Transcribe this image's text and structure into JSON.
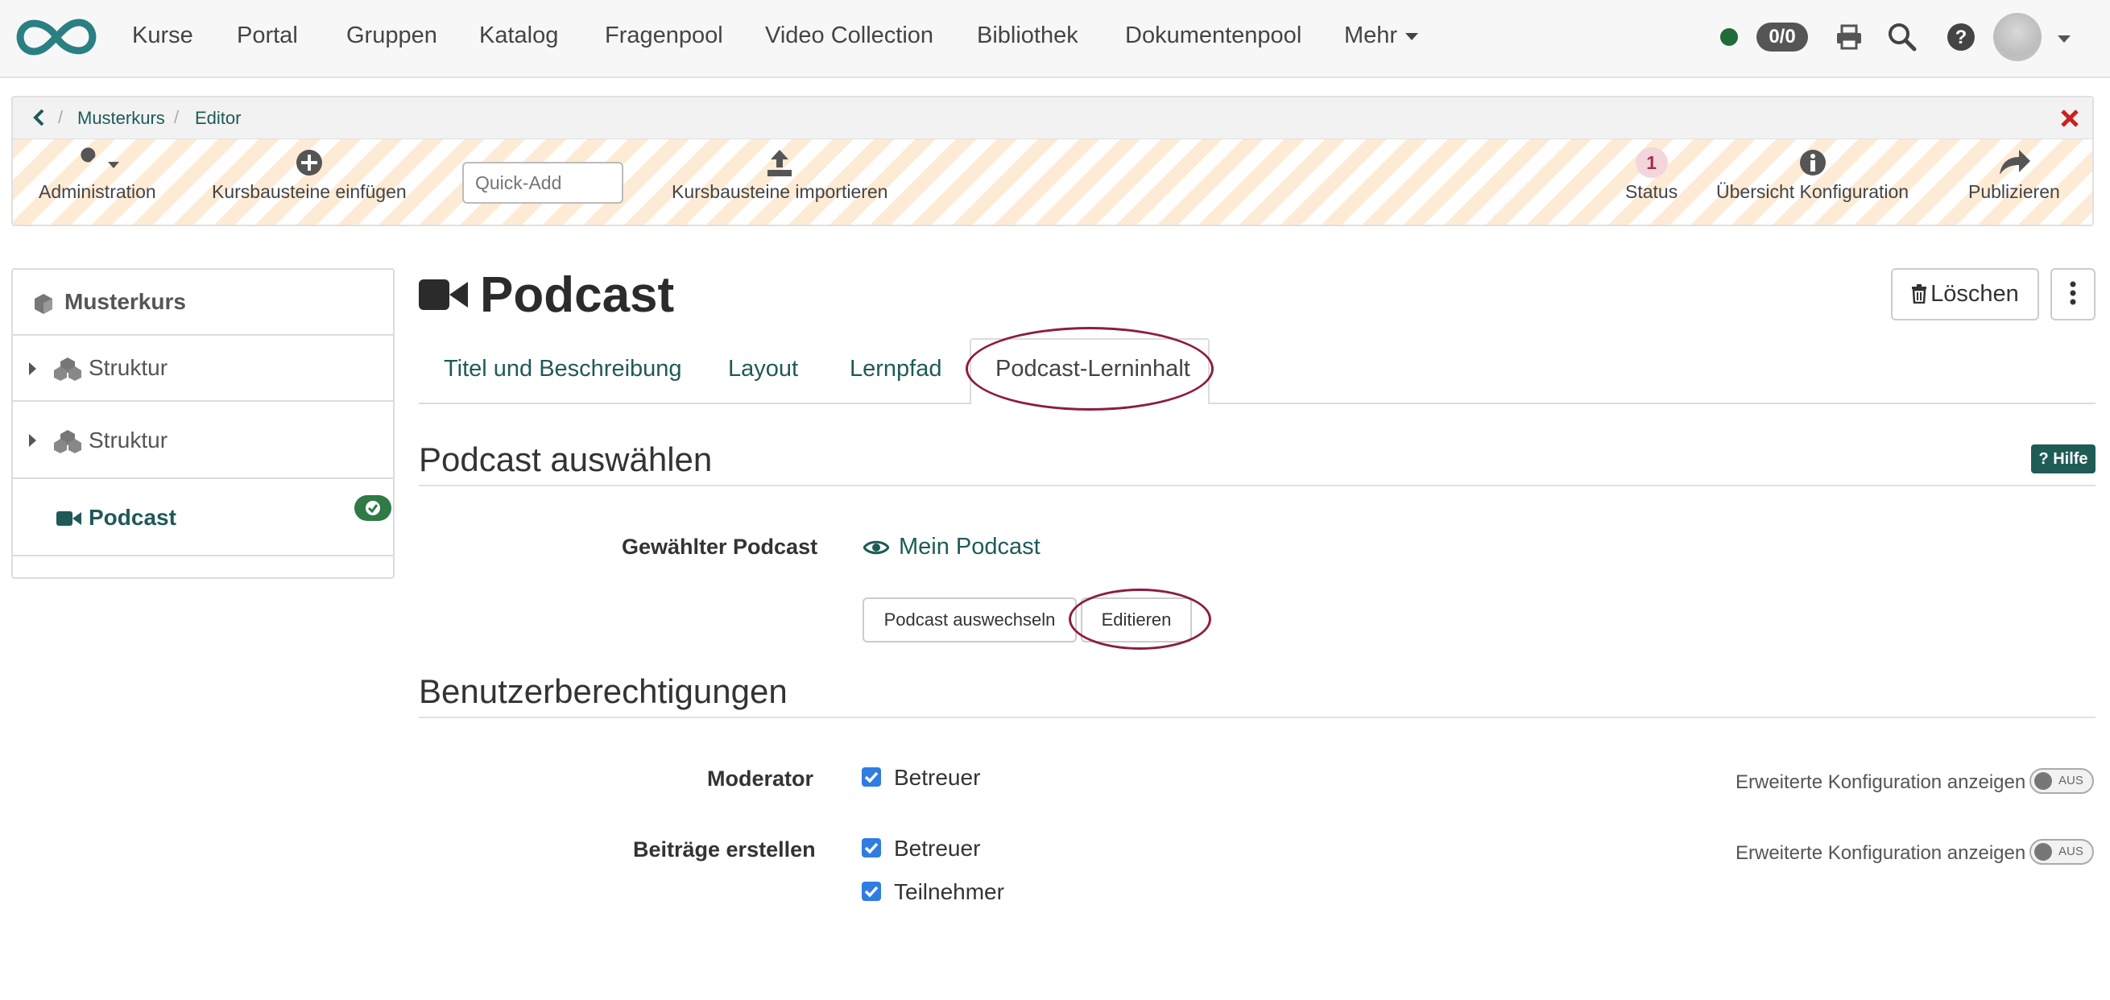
{
  "topnav": {
    "items": [
      "Kurse",
      "Portal",
      "Gruppen",
      "Katalog",
      "Fragenpool",
      "Video Collection",
      "Bibliothek",
      "Dokumentenpool",
      "Mehr"
    ],
    "counter": "0/0"
  },
  "breadcrumb": [
    "Musterkurs",
    "Editor"
  ],
  "toolbar": {
    "administration": "Administration",
    "insert": "Kursbausteine einfügen",
    "quickadd_placeholder": "Quick-Add",
    "import": "Kursbausteine importieren",
    "status": "Status",
    "status_count": "1",
    "overview": "Übersicht Konfiguration",
    "publish": "Publizieren"
  },
  "sidebar": {
    "course": "Musterkurs",
    "items": [
      "Struktur",
      "Struktur",
      "Podcast"
    ]
  },
  "main": {
    "title": "Podcast",
    "delete_label": "Löschen",
    "tabs": [
      "Titel und Beschreibung",
      "Layout",
      "Lernpfad",
      "Podcast-Lerninhalt"
    ],
    "section_select": "Podcast auswählen",
    "help_label": "Hilfe",
    "selected_label": "Gewählter Podcast",
    "selected_value": "Mein Podcast",
    "btn_switch": "Podcast auswechseln",
    "btn_edit": "Editieren",
    "section_perms": "Benutzerberechtigungen",
    "perm_moderator": "Moderator",
    "perm_create": "Beiträge erstellen",
    "role_coach": "Betreuer",
    "role_participant": "Teilnehmer",
    "ext_config": "Erweiterte Konfiguration anzeigen",
    "toggle_off": "AUS"
  },
  "colors": {
    "accent": "#1e5a57",
    "highlight": "#8b1d45",
    "checkbox": "#2f7de1",
    "success": "#2f7a45"
  }
}
